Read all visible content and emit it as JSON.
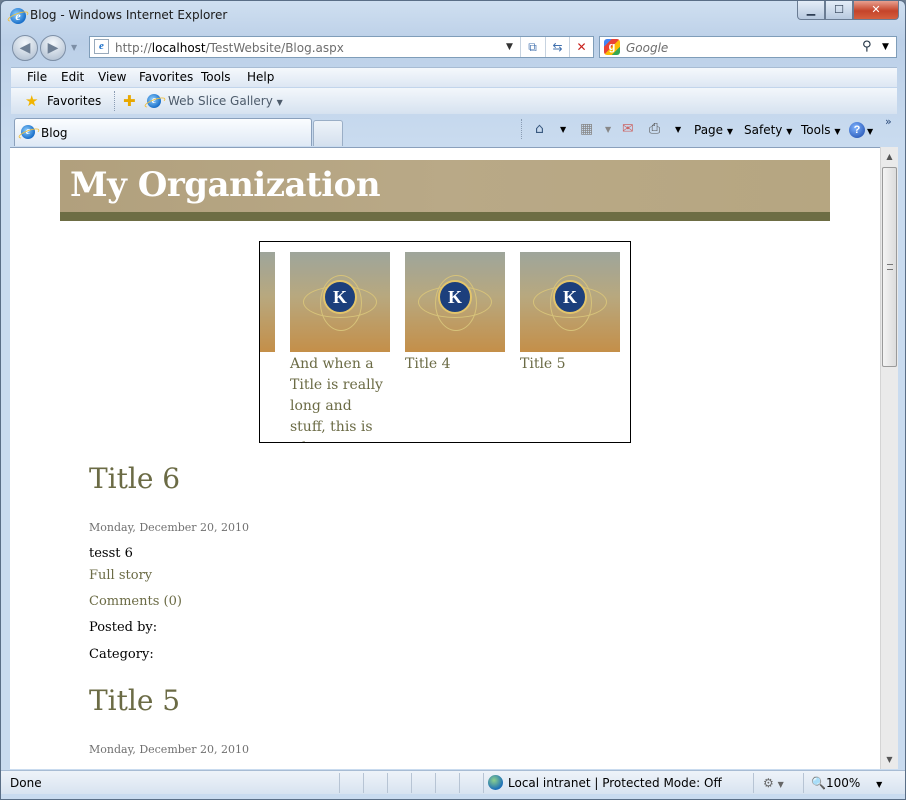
{
  "window": {
    "title": "Blog - Windows Internet Explorer",
    "buttons": {
      "minimize": "▁",
      "maximize": "☐",
      "close": "✕"
    }
  },
  "navigation": {
    "back": "◀",
    "forward": "▶",
    "address_prefix": "http://",
    "address_host": "localhost",
    "address_path": "/TestWebsite/Blog.aspx",
    "search_placeholder": "Google"
  },
  "menu": [
    {
      "label": "File"
    },
    {
      "label": "Edit"
    },
    {
      "label": "View"
    },
    {
      "label": "Favorites"
    },
    {
      "label": "Tools"
    },
    {
      "label": "Help"
    }
  ],
  "favorites_bar": {
    "favorites_label": "Favorites",
    "web_slice_label": "Web Slice Gallery"
  },
  "tabs": [
    {
      "label": "Blog",
      "active": true
    }
  ],
  "command_bar": {
    "page": "Page",
    "safety": "Safety",
    "tools": "Tools",
    "help": "?"
  },
  "page": {
    "site_title": "My Organization",
    "carousel": [
      {
        "caption": ""
      },
      {
        "caption": "And when a Title is really long and stuff, this is what"
      },
      {
        "caption": "Title 4"
      },
      {
        "caption": "Title 5"
      }
    ],
    "posts": [
      {
        "title": "Title 6",
        "date": "Monday, December 20, 2010",
        "body": "tesst 6",
        "full_story": "Full story",
        "comments": "Comments (0)",
        "posted_by": "Posted by:",
        "category": "Category:"
      },
      {
        "title": "Title 5",
        "date": "Monday, December 20, 2010"
      }
    ]
  },
  "status_bar": {
    "status": "Done",
    "zone": "Local intranet | Protected Mode: Off",
    "zoom": "100%"
  },
  "colors": {
    "banner": "#b3a380",
    "banner_strip": "#6d6d44",
    "link_olive": "#6b6b45"
  }
}
